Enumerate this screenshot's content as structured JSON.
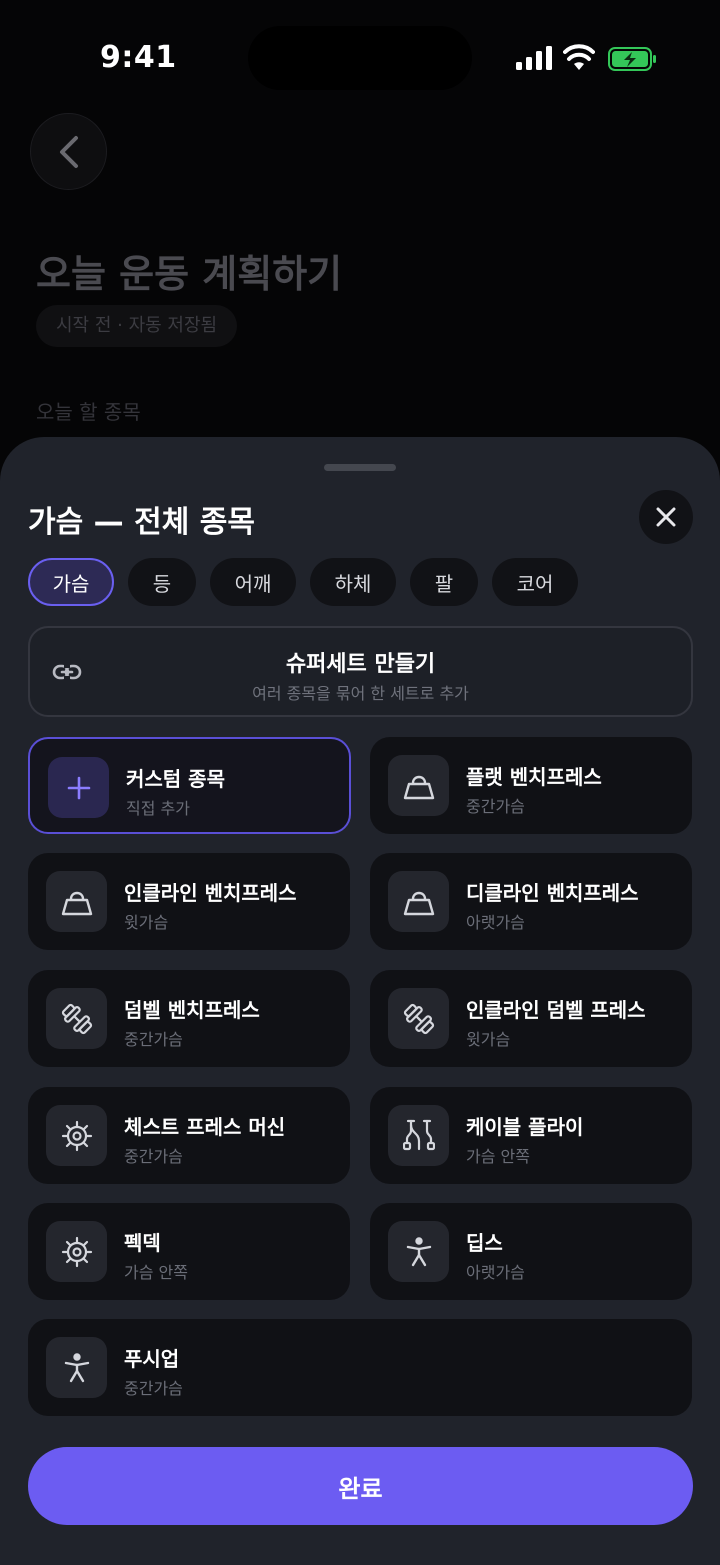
{
  "status_bar": {
    "time": "9:41",
    "battery_color": "#34c759"
  },
  "background_page": {
    "title": "오늘 운동 계획하기",
    "status_chip": "시작 전 · 자동 저장됨",
    "section_label": "오늘 할 종목"
  },
  "sheet": {
    "title": "가슴 — 전체 종목",
    "tabs": [
      {
        "label": "가슴",
        "active": true
      },
      {
        "label": "등",
        "active": false
      },
      {
        "label": "어깨",
        "active": false
      },
      {
        "label": "하체",
        "active": false
      },
      {
        "label": "팔",
        "active": false
      },
      {
        "label": "코어",
        "active": false
      }
    ],
    "superset": {
      "title": "슈퍼세트 만들기",
      "subtitle": "여러 종목을 묶어 한 세트로 추가"
    },
    "exercises": [
      {
        "name": "커스텀 종목",
        "sub": "직접 추가",
        "icon": "plus-icon",
        "selected": true
      },
      {
        "name": "플랫 벤치프레스",
        "sub": "중간가슴",
        "icon": "kettlebell-icon"
      },
      {
        "name": "인클라인 벤치프레스",
        "sub": "윗가슴",
        "icon": "kettlebell-icon"
      },
      {
        "name": "디클라인 벤치프레스",
        "sub": "아랫가슴",
        "icon": "kettlebell-icon"
      },
      {
        "name": "덤벨 벤치프레스",
        "sub": "중간가슴",
        "icon": "dumbbell-icon"
      },
      {
        "name": "인클라인 덤벨 프레스",
        "sub": "윗가슴",
        "icon": "dumbbell-icon"
      },
      {
        "name": "체스트 프레스 머신",
        "sub": "중간가슴",
        "icon": "gear-icon"
      },
      {
        "name": "케이블 플라이",
        "sub": "가슴 안쪽",
        "icon": "cable-icon"
      },
      {
        "name": "펙덱",
        "sub": "가슴 안쪽",
        "icon": "gear-icon"
      },
      {
        "name": "딥스",
        "sub": "아랫가슴",
        "icon": "person-icon"
      },
      {
        "name": "푸시업",
        "sub": "중간가슴",
        "icon": "person-icon"
      }
    ],
    "done_label": "완료",
    "accent": "#6c5cf2"
  }
}
